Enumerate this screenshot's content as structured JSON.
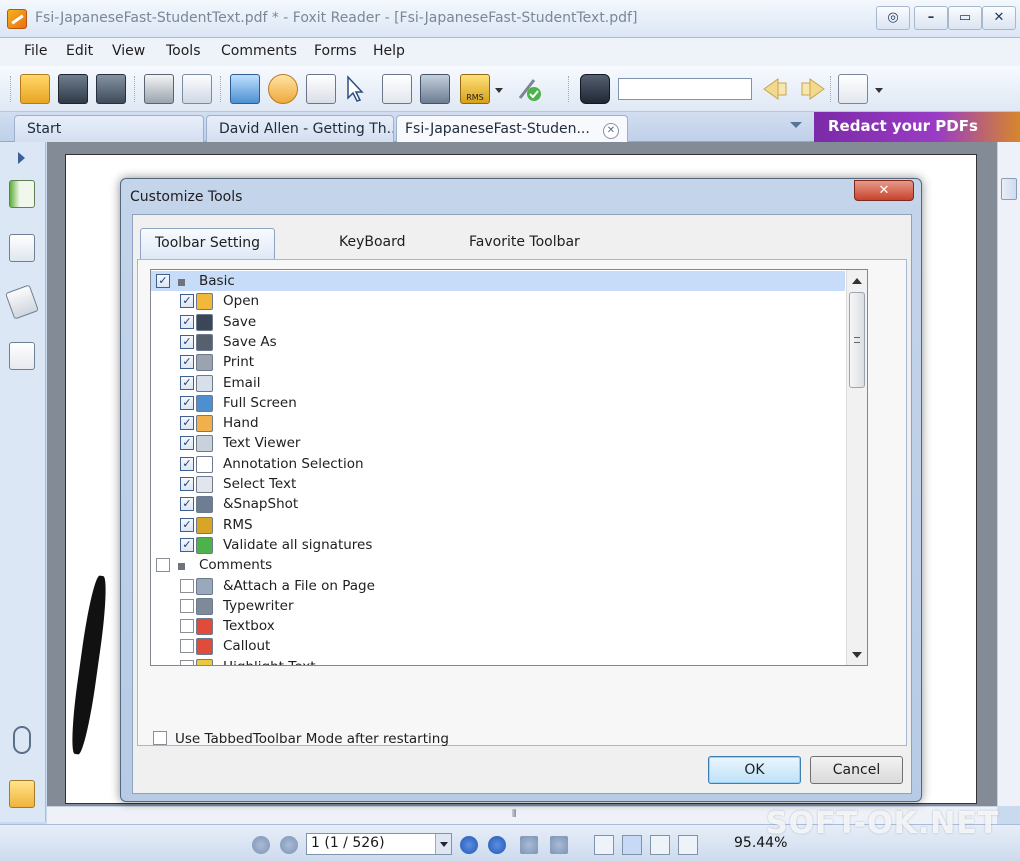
{
  "window": {
    "title": "Fsi-JapaneseFast-StudentText.pdf * - Foxit Reader - [Fsi-JapaneseFast-StudentText.pdf]"
  },
  "menu": [
    "File",
    "Edit",
    "View",
    "Tools",
    "Comments",
    "Forms",
    "Help"
  ],
  "toolbar": {
    "icons": [
      "open-folder-icon",
      "save-icon",
      "save-as-icon",
      "print-icon",
      "email-icon",
      "full-screen-icon",
      "hand-icon",
      "text-viewer-icon",
      "annotation-selection-icon",
      "select-text-icon",
      "snapshot-icon",
      "rms-icon",
      "validate-signatures-icon",
      "find-binoculars-icon",
      "find-previous-icon",
      "find-next-icon",
      "customize-icon"
    ],
    "rms_label": "RMS"
  },
  "tabs": {
    "items": [
      {
        "label": "Start"
      },
      {
        "label": "David Allen - Getting Th..."
      },
      {
        "label": "Fsi-JapaneseFast-Studen..."
      }
    ],
    "banner": "Redact your PDFs"
  },
  "dialog": {
    "title": "Customize Tools",
    "close_label": "✕",
    "tabs": [
      "Toolbar Setting",
      "KeyBoard",
      "Favorite Toolbar"
    ],
    "tree": [
      {
        "label": "Basic",
        "level": 0,
        "checked": true,
        "selected": true,
        "icon": "group-icon"
      },
      {
        "label": "Open",
        "level": 1,
        "checked": true,
        "icon": "open-folder-icon"
      },
      {
        "label": "Save",
        "level": 1,
        "checked": true,
        "icon": "save-icon"
      },
      {
        "label": "Save As",
        "level": 1,
        "checked": true,
        "icon": "save-as-icon"
      },
      {
        "label": "Print",
        "level": 1,
        "checked": true,
        "icon": "print-icon"
      },
      {
        "label": "Email",
        "level": 1,
        "checked": true,
        "icon": "email-icon"
      },
      {
        "label": "Full Screen",
        "level": 1,
        "checked": true,
        "icon": "full-screen-icon"
      },
      {
        "label": "Hand",
        "level": 1,
        "checked": true,
        "icon": "hand-icon"
      },
      {
        "label": "Text Viewer",
        "level": 1,
        "checked": true,
        "icon": "text-viewer-icon"
      },
      {
        "label": "Annotation Selection",
        "level": 1,
        "checked": true,
        "icon": "annotation-selection-icon"
      },
      {
        "label": "Select Text",
        "level": 1,
        "checked": true,
        "icon": "select-text-icon"
      },
      {
        "label": "&SnapShot",
        "level": 1,
        "checked": true,
        "icon": "snapshot-icon"
      },
      {
        "label": "RMS",
        "level": 1,
        "checked": true,
        "icon": "rms-icon"
      },
      {
        "label": "Validate all signatures",
        "level": 1,
        "checked": true,
        "icon": "validate-signatures-icon"
      },
      {
        "label": "Comments",
        "level": 0,
        "checked": false,
        "icon": "group-icon"
      },
      {
        "label": "&Attach a File on Page",
        "level": 1,
        "checked": false,
        "icon": "paperclip-icon"
      },
      {
        "label": "Typewriter",
        "level": 1,
        "checked": false,
        "icon": "typewriter-icon"
      },
      {
        "label": "Textbox",
        "level": 1,
        "checked": false,
        "icon": "textbox-icon"
      },
      {
        "label": "Callout",
        "level": 1,
        "checked": false,
        "icon": "callout-icon"
      },
      {
        "label": "Highlight Text",
        "level": 1,
        "checked": false,
        "icon": "highlight-text-icon"
      }
    ],
    "option_label": "Use TabbedToolbar Mode after restarting",
    "option_checked": false,
    "ok_label": "OK",
    "cancel_label": "Cancel"
  },
  "status": {
    "page_value": "1 (1 / 526)",
    "zoom": "95.44%"
  },
  "watermark": "SOFT-OK.NET",
  "colors": {
    "accent": "#3d6fb8",
    "banner_start": "#7b2aa8",
    "banner_end": "#d7862a"
  }
}
